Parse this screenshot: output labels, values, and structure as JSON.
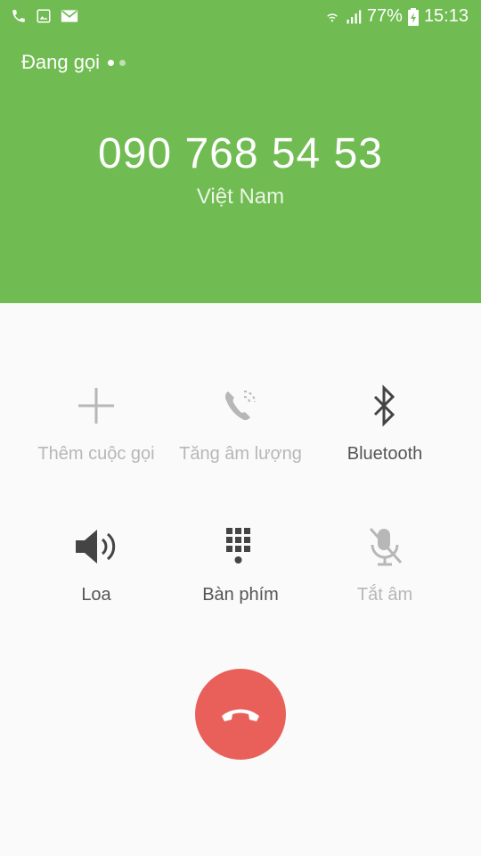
{
  "status_bar": {
    "battery_percent": "77%",
    "time": "15:13",
    "left_icons": [
      "phone-icon",
      "gallery-icon",
      "mail-icon"
    ],
    "right_icons": [
      "wifi-icon",
      "signal-icon",
      "battery-charging-icon"
    ]
  },
  "call": {
    "status": "Đang gọi",
    "number": "090 768 54 53",
    "country": "Việt Nam"
  },
  "controls": {
    "add_call": "Thêm cuộc gọi",
    "volume_boost": "Tăng âm lượng",
    "bluetooth": "Bluetooth",
    "speaker": "Loa",
    "keypad": "Bàn phím",
    "mute": "Tắt âm"
  },
  "colors": {
    "header": "#70bc52",
    "end_call": "#e9605a",
    "disabled": "#b7b7b7",
    "enabled": "#555555"
  }
}
